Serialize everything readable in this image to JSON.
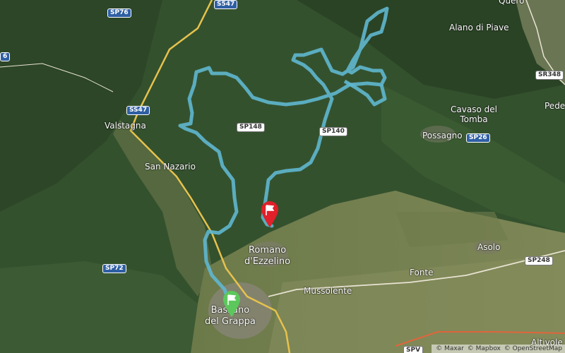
{
  "places": {
    "alano_di_piave": "Alano di Piave",
    "quero": "Quero",
    "valstagna": "Valstagna",
    "san_nazario": "San Nazario",
    "cavaso_line1": "Cavaso del",
    "cavaso_line2": "Tomba",
    "possagno": "Possagno",
    "pede": "Pede",
    "romano_line1": "Romano",
    "romano_line2": "d'Ezzelino",
    "asolo": "Asolo",
    "fonte": "Fonte",
    "mussolente": "Mussolente",
    "bassano_line1": "Bassano",
    "bassano_line2": "del Grappa",
    "altivole": "Altivole"
  },
  "roads": {
    "sp76": "SP76",
    "s547_top": "S547",
    "ss47": "SS47",
    "sp148": "SP148",
    "sp140": "SP140",
    "sp26": "SP26",
    "sr348": "SR348",
    "sp72": "SP72",
    "sp248": "SP248",
    "spv": "SPV",
    "left_edge": "6"
  },
  "route": {
    "color": "#5fb7cf",
    "start_flag_color": "#5cc85c",
    "end_flag_color": "#e0202a"
  },
  "attribution": {
    "maxar": "© Maxar",
    "mapbox": "© Mapbox",
    "osm": "© OpenStreetMap"
  }
}
